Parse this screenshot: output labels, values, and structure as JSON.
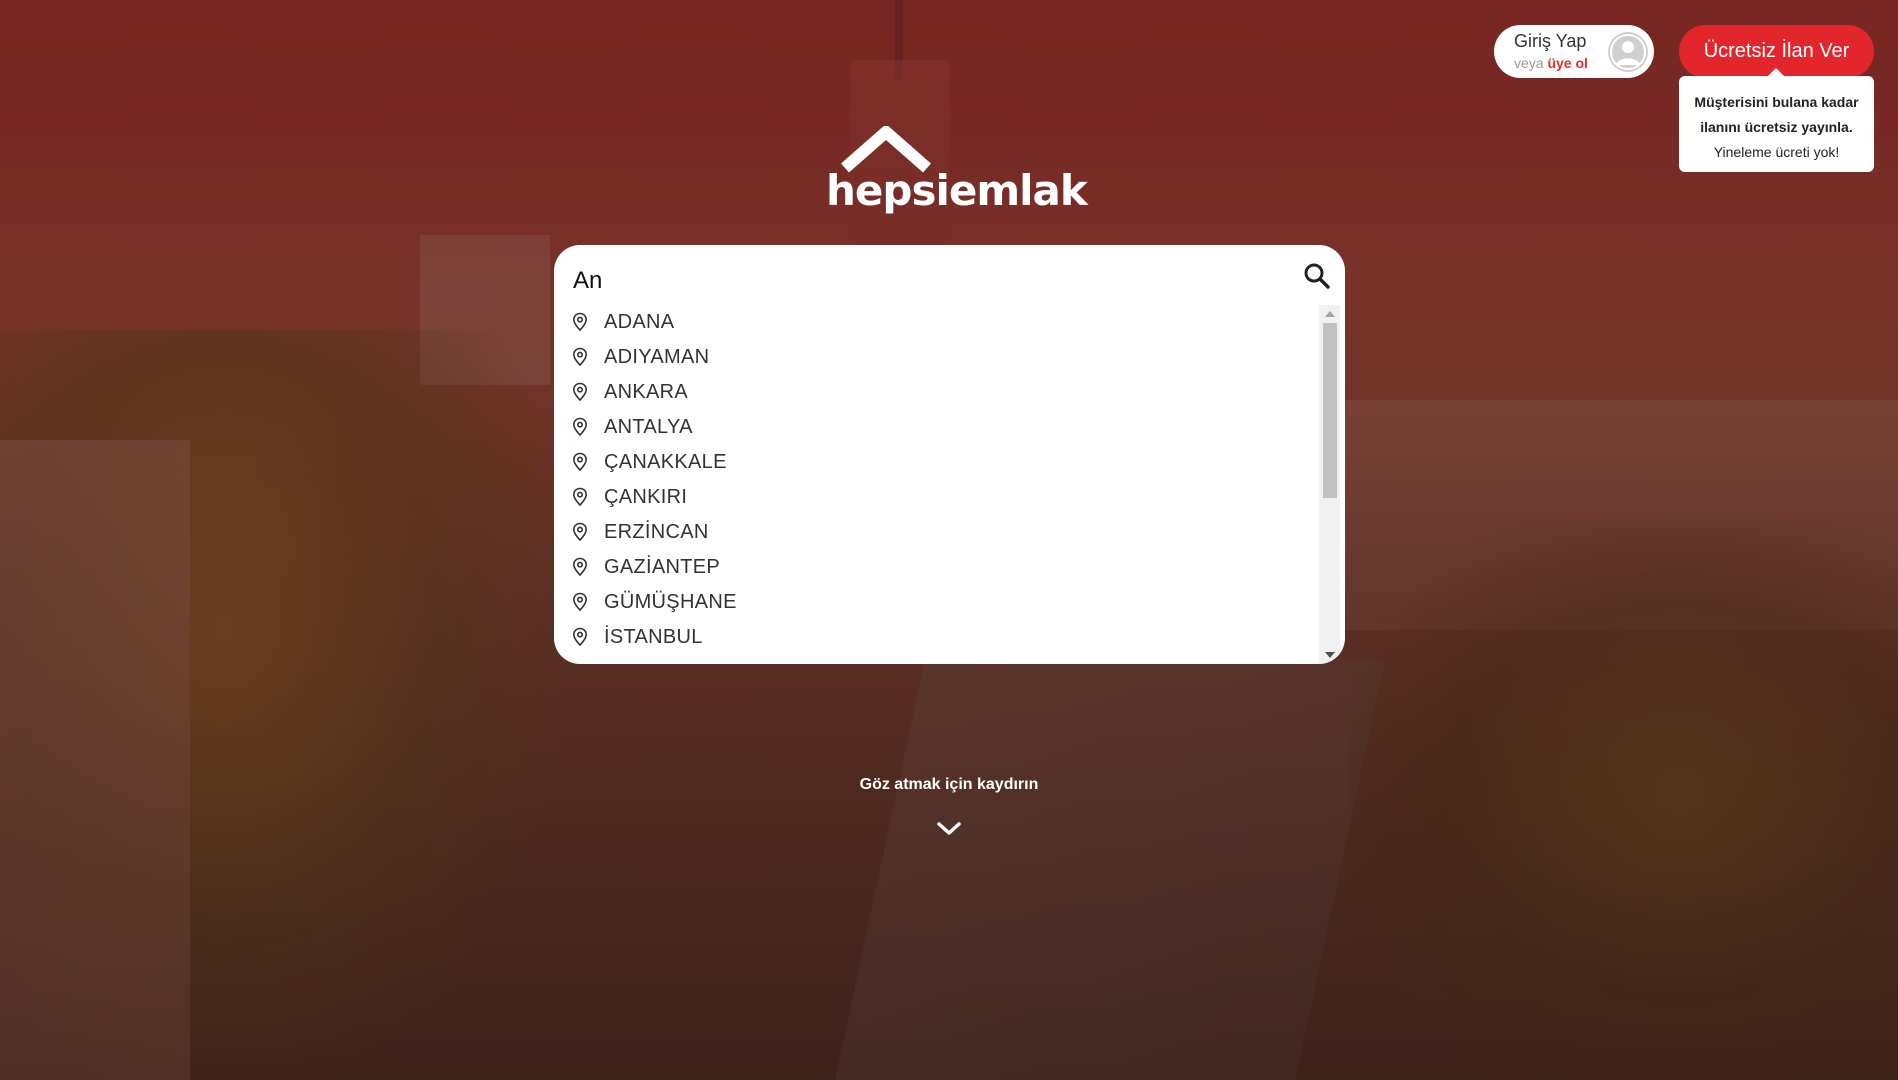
{
  "header": {
    "login_title": "Giriş Yap",
    "login_prefix": "veya",
    "signup_label": "üye ol",
    "avatar_icon": "user-avatar-icon",
    "cta_label": "Ücretsiz İlan Ver",
    "cta_tooltip_line1": "Müşterisini bulana kadar ilanını ücretsiz yayınla.",
    "cta_tooltip_line2": "Yineleme ücreti yok!"
  },
  "brand": {
    "logo_text": "hepsiemlak",
    "logo_icon": "house-roof-icon"
  },
  "search": {
    "value": "An",
    "icon": "search-icon",
    "suggestions": [
      "ADANA",
      "ADIYAMAN",
      "ANKARA",
      "ANTALYA",
      "ÇANAKKALE",
      "ÇANKIRI",
      "ERZİNCAN",
      "GAZİANTEP",
      "GÜMÜŞHANE",
      "İSTANBUL"
    ],
    "suggestion_icon": "location-pin-icon"
  },
  "hint": {
    "scroll_text": "Göz atmak için kaydırın",
    "icon": "chevron-down-icon"
  },
  "colors": {
    "accent": "#e3262c",
    "signup": "#e52b2b",
    "overlay": "#7a2a26"
  }
}
